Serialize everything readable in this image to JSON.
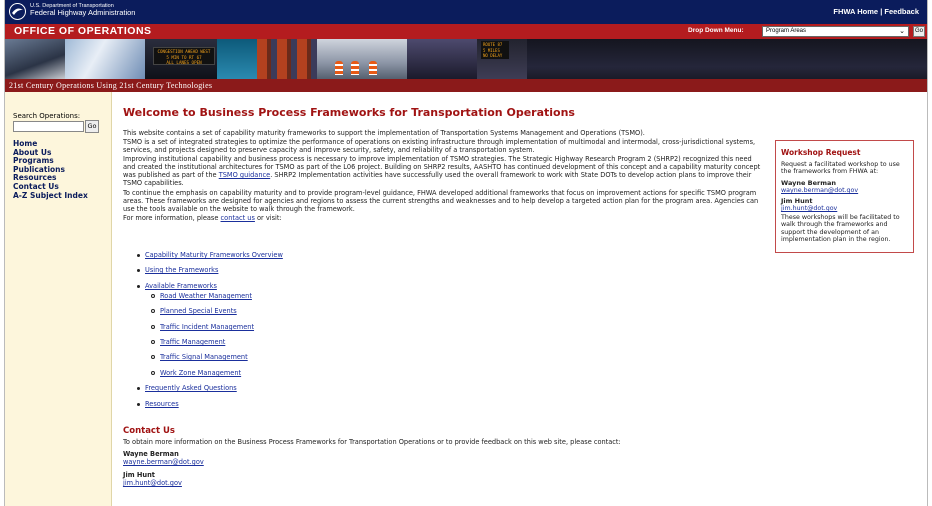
{
  "header": {
    "dept": "U.S. Department of Transportation",
    "agency": "Federal Highway Administration",
    "links": [
      "FHWA Home",
      "Feedback"
    ],
    "separator": "|"
  },
  "office": {
    "title": "OFFICE OF OPERATIONS",
    "dropdown_label": "Drop Down Menu:",
    "dropdown_value": "Program Areas",
    "go_label": "Go"
  },
  "banner": {
    "sign_text": [
      "CONGESTION AHEAD WEST",
      "5 MIN TO RT 67",
      "ALL LANES OPEN"
    ],
    "sign2_text": [
      "ROUTE 87",
      "5 MILES",
      "NO DELAY"
    ]
  },
  "subtitle": "21st Century Operations Using 21st Century Technologies",
  "sidebar": {
    "search_label": "Search Operations:",
    "search_value": "",
    "go_label": "Go",
    "nav": [
      "Home",
      "About Us",
      "Programs",
      "Publications",
      "Resources",
      "Contact Us",
      "A-Z Subject Index"
    ]
  },
  "main": {
    "title": "Welcome to Business Process Frameworks for Transportation Operations",
    "p1": "This website contains a set of capability maturity frameworks to support the implementation of Transportation Systems Management and Operations (TSMO).",
    "p2": "TSMO is a set of integrated strategies to optimize the performance of operations on existing infrastructure through implementation of multimodal and intermodal, cross-jurisdictional systems, services, and projects designed to preserve capacity and improve security, safety, and reliability of a transportation system.",
    "p3a": "Improving institutional capability and business process is necessary to improve implementation of TSMO strategies. The Strategic Highway Research Program 2 (SHRP2) recognized this need and created the institutional architectures for TSMO as part of the L06 project. Building on SHRP2 results, AASHTO has continued development of this concept and a capability maturity concept was published as part of the ",
    "p3link": "TSMO guidance",
    "p3b": ". SHRP2 Implementation activities have successfully used the overall framework to work with State DOTs to develop action plans to improve their TSMO capabilities.",
    "p4": "To continue the emphasis on capability maturity and to provide program-level guidance, FHWA developed additional frameworks that focus on improvement actions for specific TSMO program areas. These frameworks are designed for agencies and regions to assess the current strengths and weaknesses and to help develop a targeted action plan for the program area. Agencies can use the tools available on the website to walk through the framework.",
    "p5a": "For more information, please ",
    "p5link": "contact us",
    "p5b": " or visit:",
    "links": [
      "Capability Maturity Frameworks Overview",
      "Using the Frameworks",
      "Available Frameworks"
    ],
    "sublinks": [
      "Road Weather Management",
      "Planned Special Events",
      "Traffic Incident Management",
      "Traffic Management",
      "Traffic Signal Management",
      "Work Zone Management"
    ],
    "links2": [
      "Frequently Asked Questions",
      "Resources"
    ],
    "contact_title": "Contact Us",
    "contact_text": "To obtain more information on the Business Process Frameworks for Transportation Operations or to provide feedback on this web site, please contact:",
    "contacts": [
      {
        "name": "Wayne Berman",
        "email": "wayne.berman@dot.gov"
      },
      {
        "name": "Jim Hunt",
        "email": "jim.hunt@dot.gov"
      }
    ]
  },
  "workshop": {
    "title": "Workshop Request",
    "text": "Request a facilitated workshop to use the frameworks from FHWA at:",
    "contacts": [
      {
        "name": "Wayne Berman",
        "email": "wayne.berman@dot.gov"
      },
      {
        "name": "Jim Hunt",
        "email": "jim.hunt@dot.gov"
      }
    ],
    "note": "These workshops will be facilitated to walk through the frameworks and support the development of an implementation plan in the region."
  },
  "colors": {
    "navy": "#0b1c5c",
    "red": "#b41c1f",
    "link": "#1a2f9c",
    "heading": "#a01313"
  }
}
